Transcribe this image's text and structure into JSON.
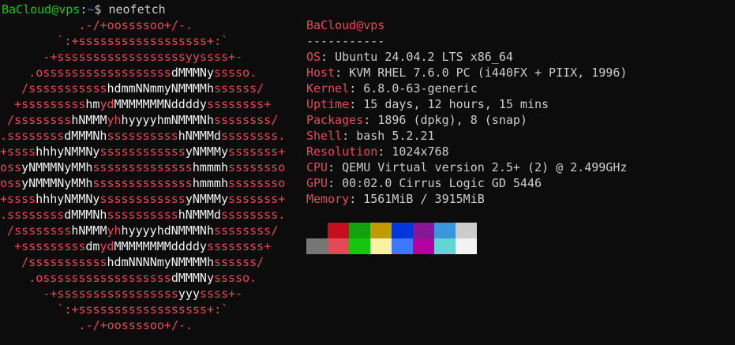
{
  "prompt": {
    "user": "BaCloud@vps",
    "sep": ":",
    "path": "~",
    "symbol": "$ ",
    "command": "neofetch"
  },
  "ascii_logo": [
    [
      [
        ".-/+oossssoo+/-.",
        "r"
      ]
    ],
    [
      [
        "`:+ssssssssssssssssss+:`",
        "r"
      ]
    ],
    [
      [
        "-+ssssssssssssssssssyyssss+-",
        "r"
      ]
    ],
    [
      [
        ".ossssssssssssssssss",
        "r"
      ],
      [
        "dMMMNy",
        "w"
      ],
      [
        "sssso.",
        "r"
      ]
    ],
    [
      [
        "/sssssssssss",
        "r"
      ],
      [
        "hdmmNNmmyNMMMMh",
        "w"
      ],
      [
        "ssssss/",
        "r"
      ]
    ],
    [
      [
        "+sssssssss",
        "r"
      ],
      [
        "hm",
        "w"
      ],
      [
        "yd",
        "r"
      ],
      [
        "MMMMMMMNddddy",
        "w"
      ],
      [
        "ssssssss+",
        "r"
      ]
    ],
    [
      [
        "/ssssssss",
        "r"
      ],
      [
        "hNMMM",
        "w"
      ],
      [
        "yh",
        "r"
      ],
      [
        "hyyyyhmNMMMNh",
        "w"
      ],
      [
        "ssssssss/",
        "r"
      ]
    ],
    [
      [
        ".ssssssss",
        "r"
      ],
      [
        "dMMMNh",
        "w"
      ],
      [
        "ssssssssss",
        "r"
      ],
      [
        "hNMMMd",
        "w"
      ],
      [
        "ssssssss.",
        "r"
      ]
    ],
    [
      [
        "+ssss",
        "r"
      ],
      [
        "hhhyNMMNy",
        "w"
      ],
      [
        "ssssssssssss",
        "r"
      ],
      [
        "yNMMMy",
        "w"
      ],
      [
        "sssssss+",
        "r"
      ]
    ],
    [
      [
        "oss",
        "r"
      ],
      [
        "yNMMMNyMMh",
        "w"
      ],
      [
        "ssssssssssssss",
        "r"
      ],
      [
        "hmmmh",
        "w"
      ],
      [
        "ssssssso",
        "r"
      ]
    ],
    [
      [
        "oss",
        "r"
      ],
      [
        "yNMMMNyMMh",
        "w"
      ],
      [
        "ssssssssssssss",
        "r"
      ],
      [
        "hmmmh",
        "w"
      ],
      [
        "ssssssso",
        "r"
      ]
    ],
    [
      [
        "+ssss",
        "r"
      ],
      [
        "hhhyNMMNy",
        "w"
      ],
      [
        "ssssssssssss",
        "r"
      ],
      [
        "yNMMMy",
        "w"
      ],
      [
        "sssssss+",
        "r"
      ]
    ],
    [
      [
        ".ssssssss",
        "r"
      ],
      [
        "dMMMNh",
        "w"
      ],
      [
        "ssssssssss",
        "r"
      ],
      [
        "hNMMMd",
        "w"
      ],
      [
        "ssssssss.",
        "r"
      ]
    ],
    [
      [
        "/ssssssss",
        "r"
      ],
      [
        "hNMMM",
        "w"
      ],
      [
        "yh",
        "r"
      ],
      [
        "hyyyyhdNMMMNh",
        "w"
      ],
      [
        "ssssssss/",
        "r"
      ]
    ],
    [
      [
        "+sssssssss",
        "r"
      ],
      [
        "dm",
        "w"
      ],
      [
        "yd",
        "r"
      ],
      [
        "MMMMMMMMddddy",
        "w"
      ],
      [
        "ssssssss+",
        "r"
      ]
    ],
    [
      [
        "/sssssssssss",
        "r"
      ],
      [
        "hdmNNNNmyNMMMMh",
        "w"
      ],
      [
        "ssssss/",
        "r"
      ]
    ],
    [
      [
        ".ossssssssssssssssss",
        "r"
      ],
      [
        "dMMMNy",
        "w"
      ],
      [
        "sssso.",
        "r"
      ]
    ],
    [
      [
        "-+sssssssssssssssss",
        "r"
      ],
      [
        "yyy",
        "w"
      ],
      [
        "ssss+-",
        "r"
      ]
    ],
    [
      [
        "`:+ssssssssssssssssss+:`",
        "r"
      ]
    ],
    [
      [
        ".-/+oossssoo+/-.",
        "r"
      ]
    ]
  ],
  "ascii_indent": [
    11,
    8,
    6,
    4,
    3,
    2,
    1,
    0,
    0,
    0,
    0,
    0,
    0,
    1,
    2,
    3,
    4,
    6,
    8,
    11
  ],
  "info": {
    "header": "BaCloud@vps",
    "separator": "-----------",
    "rows": [
      {
        "key": "OS",
        "value": "Ubuntu 24.04.2 LTS x86_64"
      },
      {
        "key": "Host",
        "value": "KVM RHEL 7.6.0 PC (i440FX + PIIX, 1996)"
      },
      {
        "key": "Kernel",
        "value": "6.8.0-63-generic"
      },
      {
        "key": "Uptime",
        "value": "15 days, 12 hours, 15 mins"
      },
      {
        "key": "Packages",
        "value": "1896 (dpkg), 8 (snap)"
      },
      {
        "key": "Shell",
        "value": "bash 5.2.21"
      },
      {
        "key": "Resolution",
        "value": "1024x768"
      },
      {
        "key": "CPU",
        "value": "QEMU Virtual version 2.5+ (2) @ 2.499GHz"
      },
      {
        "key": "GPU",
        "value": "00:02.0 Cirrus Logic GD 5446"
      },
      {
        "key": "Memory",
        "value": "1561MiB / 3915MiB"
      }
    ]
  },
  "colors": {
    "background": "#0c0c0c",
    "logo_red": "#e74856",
    "logo_white": "#f2f2f2",
    "prompt_user": "#16c60c",
    "prompt_path": "#3b78ff",
    "text": "#cccccc"
  },
  "palette": {
    "normal": [
      "#0c0c0c",
      "#c50f1f",
      "#13a10e",
      "#c19c00",
      "#0037da",
      "#881798",
      "#3a96dd",
      "#cccccc"
    ],
    "bright": [
      "#767676",
      "#e74856",
      "#16c60c",
      "#f9f1a5",
      "#3b78ff",
      "#b4009e",
      "#61d6d6",
      "#f2f2f2"
    ]
  }
}
